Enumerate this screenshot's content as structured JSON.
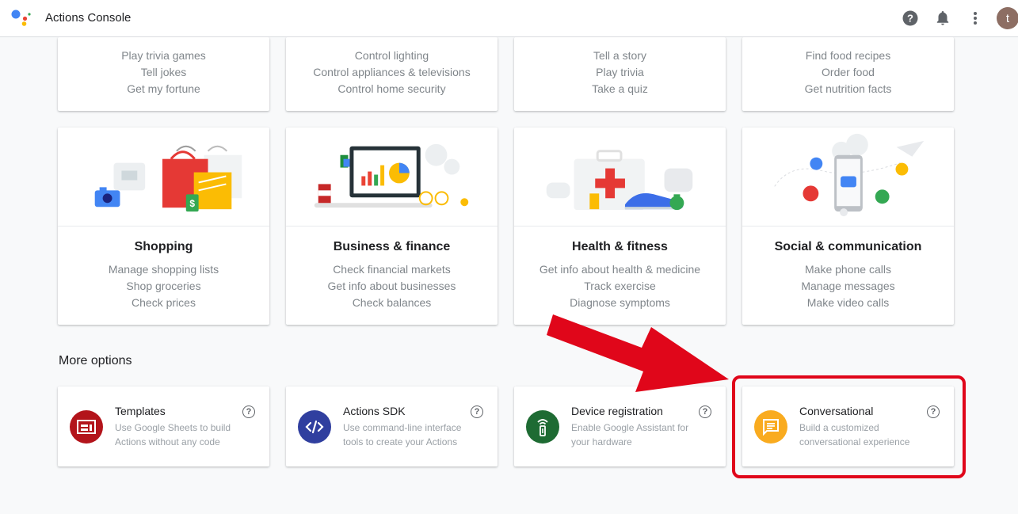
{
  "app": {
    "title": "Actions Console",
    "avatar_letter": "t"
  },
  "header": {
    "icons": [
      "help-circle-icon",
      "bell-icon",
      "more-vert-icon"
    ]
  },
  "top_cards": [
    {
      "lines": [
        "Play trivia games",
        "Tell jokes",
        "Get my fortune"
      ]
    },
    {
      "lines": [
        "Control lighting",
        "Control appliances & televisions",
        "Control home security"
      ]
    },
    {
      "lines": [
        "Tell a story",
        "Play trivia",
        "Take a quiz"
      ]
    },
    {
      "lines": [
        "Find food recipes",
        "Order food",
        "Get nutrition facts"
      ]
    }
  ],
  "categories": [
    {
      "title": "Shopping",
      "lines": [
        "Manage shopping lists",
        "Shop groceries",
        "Check prices"
      ]
    },
    {
      "title": "Business & finance",
      "lines": [
        "Check financial markets",
        "Get info about businesses",
        "Check balances"
      ]
    },
    {
      "title": "Health & fitness",
      "lines": [
        "Get info about health & medicine",
        "Track exercise",
        "Diagnose symptoms"
      ]
    },
    {
      "title": "Social & communication",
      "lines": [
        "Make phone calls",
        "Manage messages",
        "Make video calls"
      ]
    }
  ],
  "more_options": {
    "title": "More options",
    "items": [
      {
        "title": "Templates",
        "desc": "Use Google Sheets to build Actions without any code",
        "color": "#b3141b",
        "icon": "template-icon"
      },
      {
        "title": "Actions SDK",
        "desc": "Use command-line interface tools to create your Actions",
        "color": "#303f9f",
        "icon": "code-icon"
      },
      {
        "title": "Device registration",
        "desc": "Enable Google Assistant for your hardware",
        "color": "#1e6b33",
        "icon": "device-icon"
      },
      {
        "title": "Conversational",
        "desc": "Build a customized conversational experience",
        "color": "#f9ab1f",
        "icon": "chat-icon"
      }
    ],
    "help_glyph": "?"
  },
  "annotation": {
    "highlight_color": "#e0061a"
  }
}
